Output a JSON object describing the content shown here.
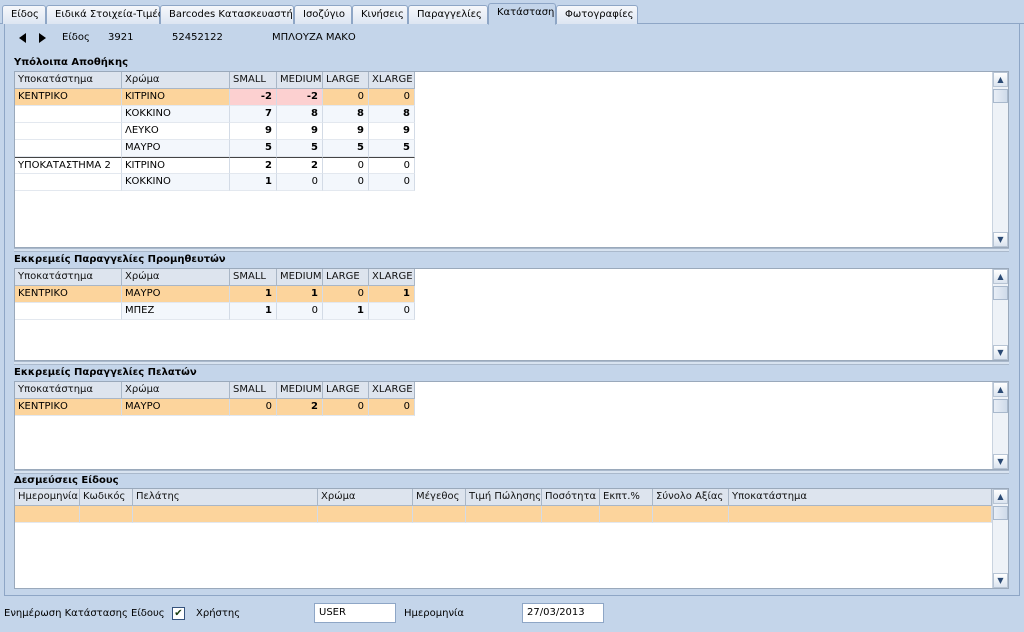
{
  "tabs": [
    "Είδος",
    "Ειδικά Στοιχεία-Τιμές",
    "Barcodes Κατασκευαστή",
    "Ισοζύγιο",
    "Κινήσεις",
    "Παραγγελίες",
    "Κατάσταση",
    "Φωτογραφίες"
  ],
  "item": {
    "label": "Είδος",
    "code": "3921",
    "barcode": "52452122",
    "description": "ΜΠΛΟΥΖΑ ΜΑΚΟ"
  },
  "sections": {
    "stock": "Υπόλοιπα Αποθήκης",
    "supplier_orders": "Εκκρεμείς Παραγγελίες Προμηθευτών",
    "customer_orders": "Εκκρεμείς Παραγγελίες Πελατών",
    "reservations": "Δεσμεύσεις Είδους"
  },
  "size_headers": [
    "Υποκατάστημα",
    "Χρώμα",
    "SMALL",
    "MEDIUM",
    "LARGE",
    "XLARGE"
  ],
  "stock_rows": [
    [
      "ΚΕΝΤΡΙΚΟ",
      "ΚΙΤΡΙΝΟ",
      "-2",
      "-2",
      "0",
      "0"
    ],
    [
      "",
      "ΚΟΚΚΙΝΟ",
      "7",
      "8",
      "8",
      "8"
    ],
    [
      "",
      "ΛΕΥΚΟ",
      "9",
      "9",
      "9",
      "9"
    ],
    [
      "",
      "ΜΑΥΡΟ",
      "5",
      "5",
      "5",
      "5"
    ],
    [
      "ΥΠΟΚΑΤΑΣΤΗΜΑ 2",
      "ΚΙΤΡΙΝΟ",
      "2",
      "2",
      "0",
      "0"
    ],
    [
      "",
      "ΚΟΚΚΙΝΟ",
      "1",
      "0",
      "0",
      "0"
    ]
  ],
  "supplier_rows": [
    [
      "ΚΕΝΤΡΙΚΟ",
      "ΜΑΥΡΟ",
      "1",
      "1",
      "0",
      "1"
    ],
    [
      "",
      "ΜΠΕΖ",
      "1",
      "0",
      "1",
      "0"
    ]
  ],
  "customer_rows": [
    [
      "ΚΕΝΤΡΙΚΟ",
      "ΜΑΥΡΟ",
      "0",
      "2",
      "0",
      "0"
    ]
  ],
  "reservation_headers": [
    "Ημερομηνία",
    "Κωδικός",
    "Πελάτης",
    "Χρώμα",
    "Μέγεθος",
    "Τιμή Πώλησης",
    "Ποσότητα",
    "Εκπτ.%",
    "Σύνολο Αξίας",
    "Υποκατάστημα"
  ],
  "footer": {
    "update_label": "Ενημέρωση Κατάστασης Είδους",
    "user_label": "Χρήστης",
    "user_checked": true,
    "user_value": "USER",
    "date_label": "Ημερομηνία",
    "date_value": "27/03/2013"
  },
  "colors": {
    "selected_row": "#fcd49c",
    "negative_cell": "#fcd0d0",
    "background": "#c4d5ea"
  }
}
